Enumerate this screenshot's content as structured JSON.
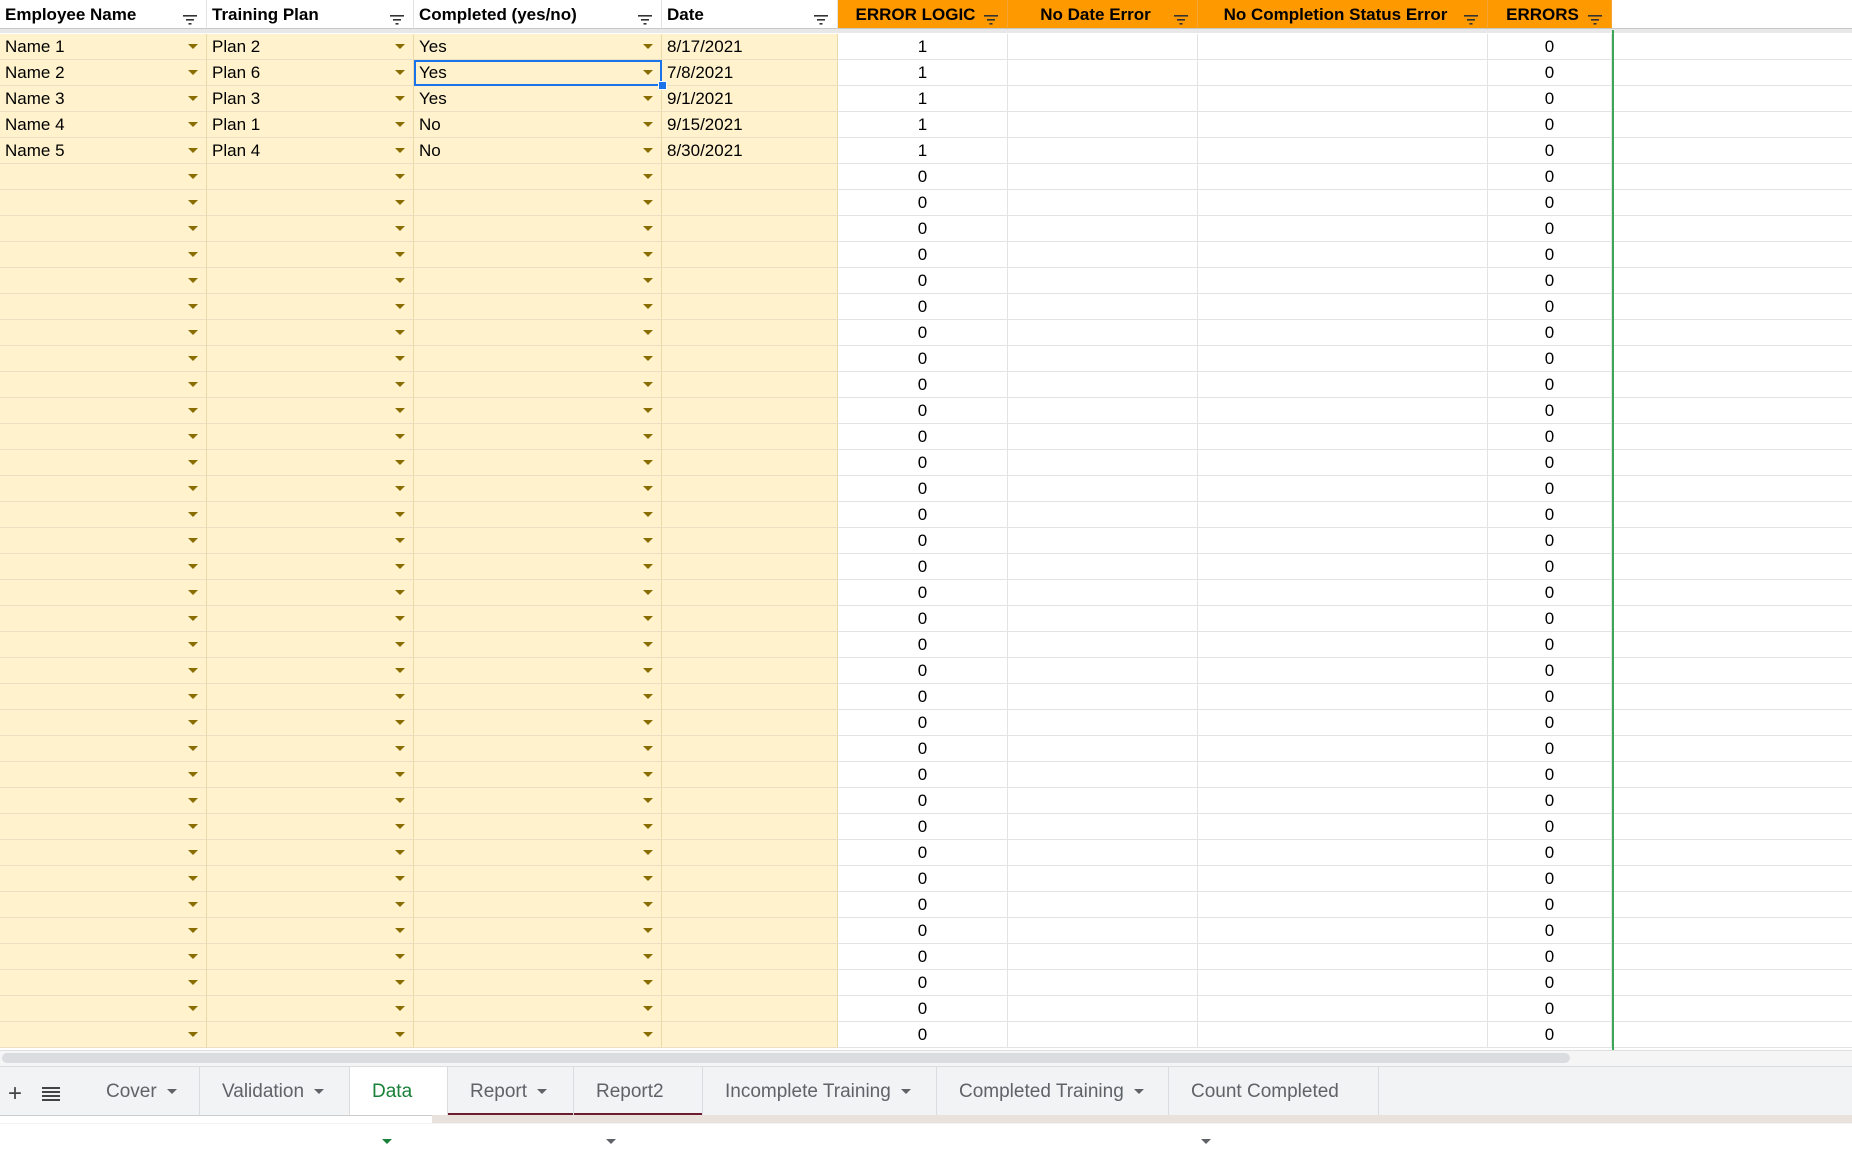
{
  "sheet": {
    "columns": [
      {
        "label": "Employee Name"
      },
      {
        "label": "Training Plan"
      },
      {
        "label": "Completed (yes/no)"
      },
      {
        "label": "Date"
      },
      {
        "label": "ERROR LOGIC"
      },
      {
        "label": "No Date Error"
      },
      {
        "label": "No Completion Status Error"
      },
      {
        "label": "ERRORS"
      }
    ],
    "filled_rows": [
      {
        "name": "Name 1",
        "plan": "Plan 2",
        "completed": "Yes",
        "date": "8/17/2021",
        "error_logic": "1",
        "errors": "0"
      },
      {
        "name": "Name 2",
        "plan": "Plan 6",
        "completed": "Yes",
        "date": "7/8/2021",
        "error_logic": "1",
        "errors": "0"
      },
      {
        "name": "Name 3",
        "plan": "Plan 3",
        "completed": "Yes",
        "date": "9/1/2021",
        "error_logic": "1",
        "errors": "0"
      },
      {
        "name": "Name 4",
        "plan": "Plan 1",
        "completed": "No",
        "date": "9/15/2021",
        "error_logic": "1",
        "errors": "0"
      },
      {
        "name": "Name 5",
        "plan": "Plan 4",
        "completed": "No",
        "date": "8/30/2021",
        "error_logic": "1",
        "errors": "0"
      }
    ],
    "empty_row_count": 34,
    "empty_error_logic": "0",
    "empty_errors": "0"
  },
  "tabs": [
    {
      "label": "Cover",
      "active": false,
      "underline": false
    },
    {
      "label": "Validation",
      "active": false,
      "underline": false
    },
    {
      "label": "Data",
      "active": true,
      "underline": false
    },
    {
      "label": "Report",
      "active": false,
      "underline": true
    },
    {
      "label": "Report2",
      "active": false,
      "underline": true
    },
    {
      "label": "Incomplete Training",
      "active": false,
      "underline": false
    },
    {
      "label": "Completed Training",
      "active": false,
      "underline": false
    },
    {
      "label": "Count Completed",
      "active": false,
      "underline": false
    }
  ],
  "icons": {
    "add_sheet": "plus-icon",
    "all_sheets": "list-icon",
    "filter": "filter-icon",
    "dropdown": "chevron-down-icon"
  },
  "colors": {
    "input_fill": "#fff2cc",
    "header_orange": "#ff9900",
    "active_tab_text": "#188038",
    "selection": "#1a73e8",
    "range_border": "#3aa757",
    "tab_underline": "#6b1d2f"
  }
}
